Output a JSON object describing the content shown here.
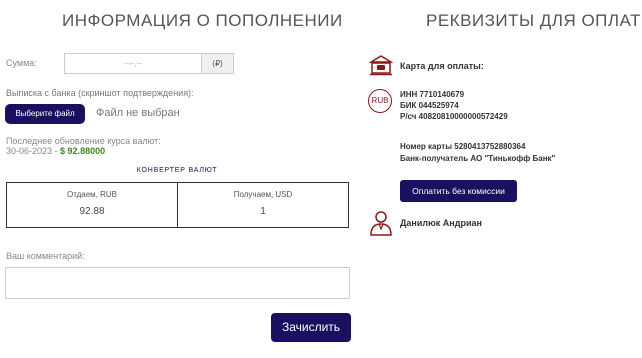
{
  "left": {
    "title": "ИНФОРМАЦИЯ О ПОПОЛНЕНИИ",
    "sum": {
      "label": "Сумма:",
      "placeholder": "----,--",
      "currency": "(₽)"
    },
    "upload": {
      "label": "Выписка с банка (скриншот подтверждения):",
      "button": "Выберите файл",
      "status": "Файл не выбран"
    },
    "rate": {
      "label": "Последнее обновление курса валют:",
      "date": "30-06-2023 - ",
      "value": "$ 92.88000"
    },
    "converter": {
      "title": "КОНВЕРТЕР ВАЛЮТ",
      "give_label": "Отдаем, RUB",
      "give_value": "92.88",
      "get_label": "Получаем, USD",
      "get_value": "1"
    },
    "comment": {
      "label": "Ваш комментарий:"
    },
    "submit": "Зачислить"
  },
  "right": {
    "title": "РЕКВИЗИТЫ ДЛЯ ОПЛАТЫ",
    "card_label": "Карта для оплаты:",
    "rub_icon": "RUB",
    "requisites": [
      "ИНН 7710140679",
      "БИК 044525974",
      "Р/сч 40820810000000572429"
    ],
    "card_number": "Номер карты 5280413752880364",
    "bank": "Банк-получатель АО \"Тинькофф Банк\"",
    "pay_button": "Оплатить без комиссии",
    "person_name": "Данилюк Андриан"
  },
  "colors": {
    "accent": "#1a1060",
    "rate_green": "#3a8a1a",
    "icon_red": "#8a1a1a"
  }
}
